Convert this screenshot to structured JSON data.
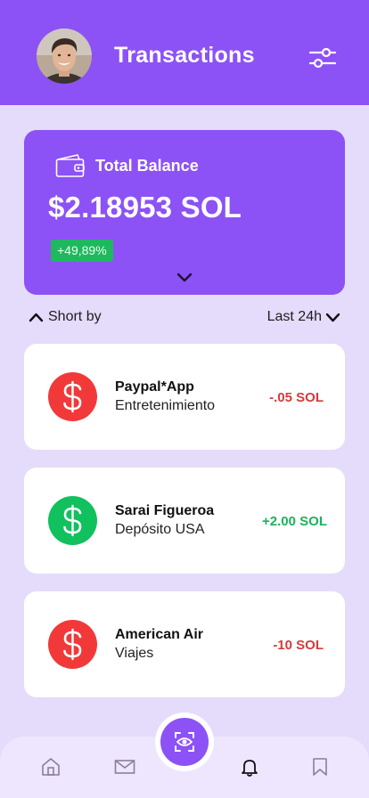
{
  "header": {
    "title": "Transactions",
    "avatar_icon": "user-avatar",
    "filter_icon": "sliders-icon"
  },
  "balance": {
    "label": "Total Balance",
    "amount": "$2.18953 SOL",
    "change": "+49,89%",
    "wallet_icon": "wallet-icon",
    "expand_icon": "chevron-down-icon"
  },
  "sort": {
    "label": "Short by",
    "period": "Last 24h"
  },
  "transactions": [
    {
      "name": "Paypal*App",
      "category": "Entretenimiento",
      "amount": "-.05 SOL",
      "type": "debit"
    },
    {
      "name": "Sarai Figueroa",
      "category": "Depósito USA",
      "amount": "+2.00 SOL",
      "type": "credit"
    },
    {
      "name": "American Air",
      "category": "Viajes",
      "amount": "-10 SOL",
      "type": "debit"
    }
  ],
  "nav": {
    "items": [
      "home-icon",
      "mail-icon",
      "scan-icon",
      "bell-icon",
      "bookmark-icon"
    ],
    "active": "bell-icon"
  },
  "colors": {
    "primary": "#8c52f5",
    "background": "#e5dbfb",
    "positive": "#10c15e",
    "negative": "#f2393a",
    "badge": "#1fb85f"
  }
}
